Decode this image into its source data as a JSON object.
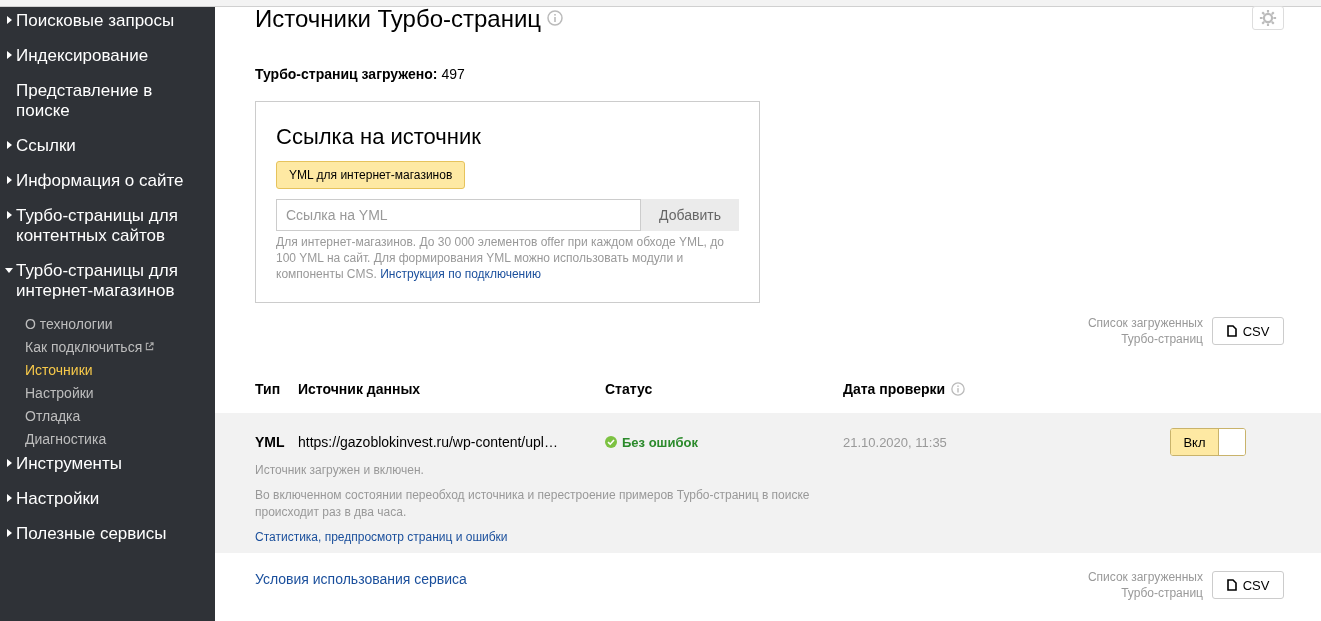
{
  "sidebar": {
    "items": [
      {
        "label": "Поисковые запросы",
        "kind": "group",
        "expanded": false
      },
      {
        "label": "Индексирование",
        "kind": "group",
        "expanded": false
      },
      {
        "label": "Представление в поиске",
        "kind": "link"
      },
      {
        "label": "Ссылки",
        "kind": "group",
        "expanded": false
      },
      {
        "label": "Информация о сайте",
        "kind": "group",
        "expanded": false
      },
      {
        "label": "Турбо-страницы для контентных сайтов",
        "kind": "group",
        "expanded": false
      },
      {
        "label": "Турбо-страницы для интернет-магазинов",
        "kind": "group",
        "expanded": true,
        "children": [
          {
            "label": "О технологии",
            "selected": false,
            "external": false
          },
          {
            "label": "Как подключиться",
            "selected": false,
            "external": true
          },
          {
            "label": "Источники",
            "selected": true,
            "external": false
          },
          {
            "label": "Настройки",
            "selected": false,
            "external": false
          },
          {
            "label": "Отладка",
            "selected": false,
            "external": false
          },
          {
            "label": "Диагностика",
            "selected": false,
            "external": false
          }
        ]
      },
      {
        "label": "Инструменты",
        "kind": "group",
        "expanded": false
      },
      {
        "label": "Настройки",
        "kind": "group",
        "expanded": false
      },
      {
        "label": "Полезные сервисы",
        "kind": "group",
        "expanded": false
      }
    ]
  },
  "page": {
    "title": "Источники Турбо-страниц",
    "loaded_label": "Турбо-страниц загружено:",
    "loaded_count": "497"
  },
  "source_card": {
    "title": "Ссылка на источник",
    "type_button": "YML для интернет-магазинов",
    "input_placeholder": "Ссылка на YML",
    "add_button": "Добавить",
    "hint": "Для интернет-магазинов. До 30 000 элементов offer при каждом обходе YML, до 100 YML на сайт. Для формирования YML можно использовать модули и компоненты CMS.",
    "hint_link": "Инструкция по подключению"
  },
  "export_top": {
    "label": "Список загруженных Турбо-страниц",
    "button": "CSV"
  },
  "table": {
    "columns": [
      "Тип",
      "Источник данных",
      "Статус",
      "Дата проверки"
    ],
    "rows": [
      {
        "type": "YML",
        "source": "https://gazoblokinvest.ru/wp-content/upl…",
        "status": "Без ошибок",
        "date": "21.10.2020, 11:35",
        "toggle_label": "Вкл",
        "on": true,
        "note": "Источник загружен и включен.",
        "description": "Во включенном состоянии переобход источника и перестроение примеров Турбо-страниц в поиске происходит раз в два часа.",
        "link": "Статистика, предпросмотр страниц и ошибки"
      }
    ]
  },
  "footer": {
    "terms_link": "Условия использования сервиса",
    "export_label": "Список загруженных Турбо-страниц",
    "export_button": "CSV"
  }
}
